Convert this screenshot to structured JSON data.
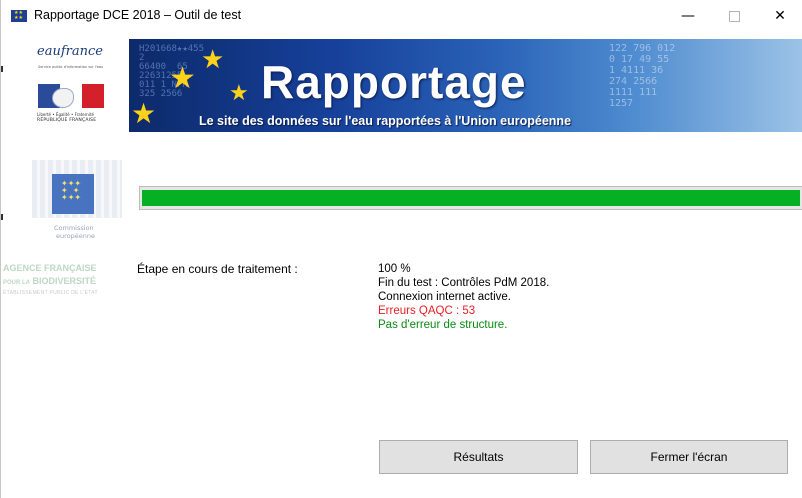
{
  "window": {
    "title": "Rapportage DCE 2018 – Outil de test",
    "controls": {
      "minimize": "—",
      "close": "✕"
    }
  },
  "logos": {
    "eaufrance": {
      "name": "eaufrance",
      "tagline": "Service public d'information sur l'eau",
      "motto": "Liberté • Égalité • Fraternité",
      "country": "RÉPUBLIQUE FRANÇAISE"
    },
    "commission": {
      "line1": "Commission",
      "line2": "européenne"
    },
    "afb": {
      "line1": "AGENCE FRANÇAISE",
      "line2_prefix": "POUR LA",
      "line2": "BIODIVERSITÉ",
      "line3": "ÉTABLISSEMENT PUBLIC DE L'ÉTAT"
    }
  },
  "banner": {
    "title": "Rapportage",
    "subtitle": "Le site des données sur l'eau rapportées à l'Union européenne"
  },
  "progress": {
    "value": 1.0,
    "color": "#06b025"
  },
  "main": {
    "step_label": "Étape en cours de traitement :",
    "status_lines": [
      {
        "text": "100 %",
        "color": "#000000"
      },
      {
        "text": "Fin du test : Contrôles PdM 2018.",
        "color": "#000000"
      },
      {
        "text": "Connexion internet active.",
        "color": "#000000"
      },
      {
        "text": "Erreurs QAQC : 53",
        "color": "#e81e25"
      },
      {
        "text": "Pas d'erreur de structure.",
        "color": "#0a8a12"
      }
    ]
  },
  "buttons": {
    "results": "Résultats",
    "close_screen": "Fermer l'écran"
  }
}
